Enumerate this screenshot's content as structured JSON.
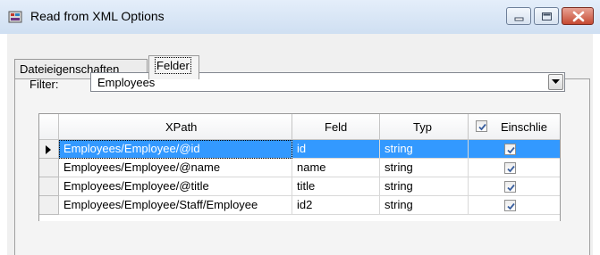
{
  "window": {
    "title": "Read from XML Options"
  },
  "tabs": [
    {
      "label": "Dateieigenschaften",
      "active": false
    },
    {
      "label": "Felder",
      "active": true
    }
  ],
  "filter": {
    "label": "Filter:",
    "value": "Employees"
  },
  "grid": {
    "columns": [
      "XPath",
      "Feld",
      "Typ",
      "Einschlie"
    ],
    "header_checkbox_checked": true,
    "rows": [
      {
        "xpath": "Employees/Employee/@id",
        "feld": "id",
        "typ": "string",
        "include": true,
        "selected": true
      },
      {
        "xpath": "Employees/Employee/@name",
        "feld": "name",
        "typ": "string",
        "include": true,
        "selected": false
      },
      {
        "xpath": "Employees/Employee/@title",
        "feld": "title",
        "typ": "string",
        "include": true,
        "selected": false
      },
      {
        "xpath": "Employees/Employee/Staff/Employee",
        "feld": "id2",
        "typ": "string",
        "include": true,
        "selected": false
      }
    ]
  },
  "colors": {
    "selection": "#3399ff",
    "titlebar": "#dbe6f4",
    "close": "#c64a32"
  },
  "icons": [
    "app-icon",
    "minimize-icon",
    "maximize-icon",
    "close-icon",
    "dropdown-arrow-icon",
    "row-selector-icon",
    "checkmark-icon"
  ]
}
